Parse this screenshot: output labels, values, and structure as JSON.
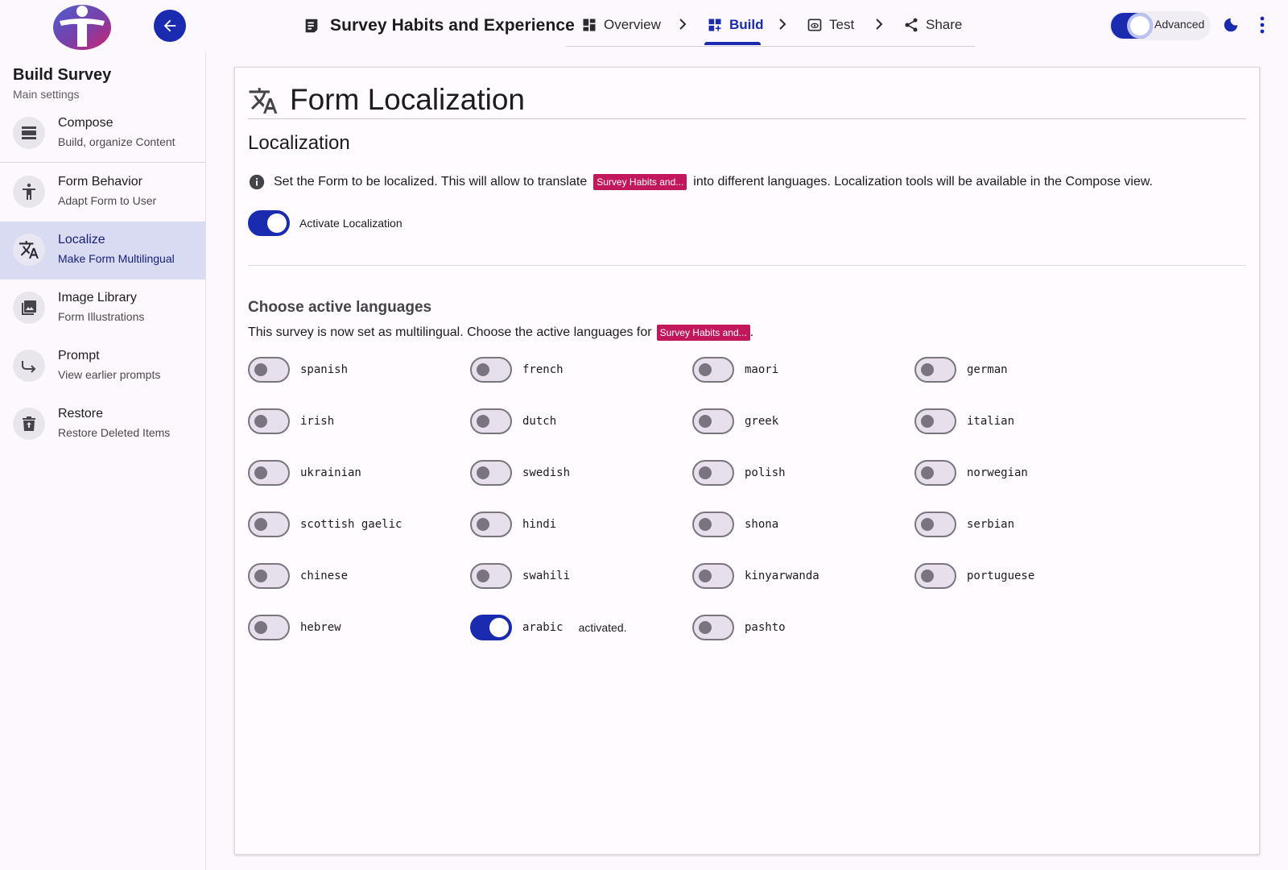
{
  "header": {
    "title": "Survey Habits and Experience",
    "steps": [
      {
        "label": "Overview",
        "icon": "dashboard-icon"
      },
      {
        "label": "Build",
        "icon": "dashboard-add-icon",
        "active": true
      },
      {
        "label": "Test",
        "icon": "preview-icon"
      },
      {
        "label": "Share",
        "icon": "share-icon"
      }
    ],
    "advanced_label": "Advanced",
    "advanced_on": true
  },
  "sidebar": {
    "title": "Build Survey",
    "subtitle": "Main settings",
    "items": [
      {
        "label": "Compose",
        "desc": "Build, organize Content",
        "icon": "compose-icon"
      },
      {
        "label": "Form Behavior",
        "desc": "Adapt Form to User",
        "icon": "accessibility-icon"
      },
      {
        "label": "Localize",
        "desc": "Make Form Multilingual",
        "icon": "translate-icon",
        "active": true
      },
      {
        "label": "Image Library",
        "desc": "Form Illustrations",
        "icon": "image-library-icon"
      },
      {
        "label": "Prompt",
        "desc": "View earlier prompts",
        "icon": "redo-arrow-icon"
      },
      {
        "label": "Restore",
        "desc": "Restore Deleted Items",
        "icon": "restore-bin-icon"
      }
    ]
  },
  "main": {
    "title": "Form Localization",
    "section_title": "Localization",
    "info_before": "Set the Form to be localized. This will allow to translate",
    "info_chip": "Survey Habits and...",
    "info_after": "into different languages. Localization tools will be available in the Compose view.",
    "activate_label": "Activate Localization",
    "activate_on": true,
    "choose_title": "Choose active languages",
    "choose_text": "This survey is now set as multilingual. Choose the active languages for",
    "choose_chip": "Survey Habits and...",
    "choose_end": ".",
    "languages": [
      {
        "name": "spanish",
        "on": false
      },
      {
        "name": "french",
        "on": false
      },
      {
        "name": "maori",
        "on": false
      },
      {
        "name": "german",
        "on": false
      },
      {
        "name": "irish",
        "on": false
      },
      {
        "name": "dutch",
        "on": false
      },
      {
        "name": "greek",
        "on": false
      },
      {
        "name": "italian",
        "on": false
      },
      {
        "name": "ukrainian",
        "on": false
      },
      {
        "name": "swedish",
        "on": false
      },
      {
        "name": "polish",
        "on": false
      },
      {
        "name": "norwegian",
        "on": false
      },
      {
        "name": "scottish gaelic",
        "on": false
      },
      {
        "name": "hindi",
        "on": false
      },
      {
        "name": "shona",
        "on": false
      },
      {
        "name": "serbian",
        "on": false
      },
      {
        "name": "chinese",
        "on": false
      },
      {
        "name": "swahili",
        "on": false
      },
      {
        "name": "kinyarwanda",
        "on": false
      },
      {
        "name": "portuguese",
        "on": false
      },
      {
        "name": "hebrew",
        "on": false
      },
      {
        "name": "arabic",
        "on": true,
        "note": "activated."
      },
      {
        "name": "pashto",
        "on": false
      }
    ]
  },
  "colors": {
    "primary": "#1a2bb0",
    "chip": "#c2185b",
    "active_nav": "#d9dbf2"
  }
}
